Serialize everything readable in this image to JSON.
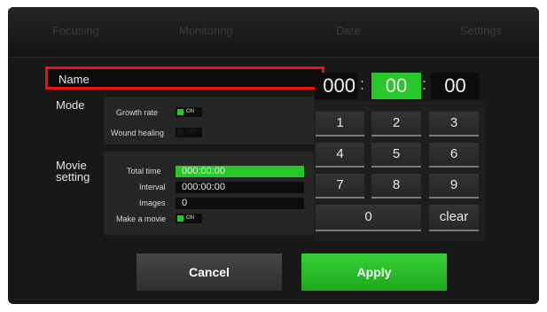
{
  "tabs": [
    "Focusing",
    "Monitoring",
    "Date",
    "Settings"
  ],
  "name": {
    "label": "Name",
    "value": ""
  },
  "mode": {
    "label": "Mode",
    "growth_rate": {
      "label": "Growth rate",
      "state": "ON"
    },
    "wound_healing": {
      "label": "Wound healing",
      "state": "OFF"
    }
  },
  "movie": {
    "label_line1": "Movie",
    "label_line2": "setting",
    "total_time": {
      "label": "Total time",
      "value": "000:00:00"
    },
    "interval": {
      "label": "Interval",
      "value": "000:00:00"
    },
    "images": {
      "label": "Images",
      "value": "0"
    },
    "make_movie": {
      "label": "Make a movie",
      "state": "ON"
    }
  },
  "time": {
    "hours": "000",
    "minutes": "00",
    "seconds": "00",
    "sep": ":"
  },
  "keypad": {
    "keys": [
      "1",
      "2",
      "3",
      "4",
      "5",
      "6",
      "7",
      "8",
      "9"
    ],
    "zero": "0",
    "clear": "clear"
  },
  "buttons": {
    "cancel": "Cancel",
    "apply": "Apply"
  },
  "colors": {
    "accent_green": "#28c828",
    "highlight_red": "#ee1111"
  }
}
